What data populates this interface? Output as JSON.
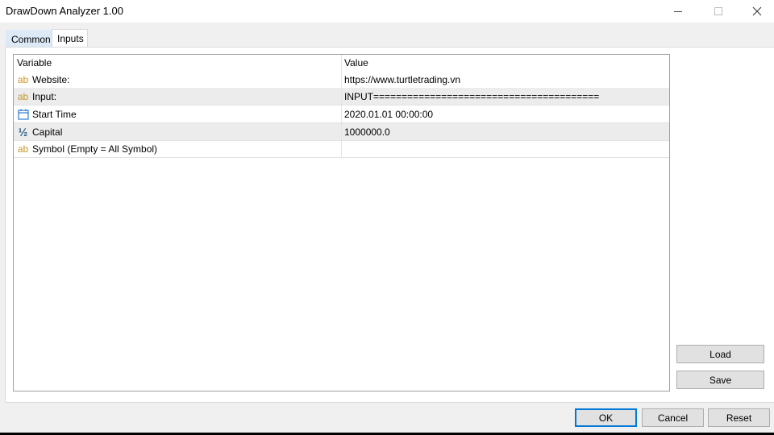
{
  "window": {
    "title": "DrawDown Analyzer 1.00",
    "controls": [
      "minimize-icon",
      "maximize-icon",
      "close-icon"
    ]
  },
  "tabs": [
    {
      "label": "Common",
      "active": false
    },
    {
      "label": "Inputs",
      "active": true
    }
  ],
  "grid": {
    "columns": [
      "Variable",
      "Value"
    ],
    "rows": [
      {
        "icon": "ab-text-icon",
        "icon_glyph": "ab",
        "variable": "Website:",
        "value": "https://www.turtletrading.vn"
      },
      {
        "icon": "ab-text-icon",
        "icon_glyph": "ab",
        "variable": "Input:",
        "value": "INPUT========================================"
      },
      {
        "icon": "calendar-icon",
        "icon_glyph": "",
        "variable": "Start Time",
        "value": "2020.01.01 00:00:00"
      },
      {
        "icon": "fraction-icon",
        "icon_glyph": "½",
        "variable": "Capital",
        "value": "1000000.0"
      },
      {
        "icon": "ab-text-icon",
        "icon_glyph": "ab",
        "variable": "Symbol  (Empty = All Symbol)",
        "value": ""
      }
    ]
  },
  "side_buttons": {
    "load": "Load",
    "save": "Save"
  },
  "footer_buttons": {
    "ok": "OK",
    "cancel": "Cancel",
    "reset": "Reset"
  },
  "colors": {
    "ab_icon": "#c9962a",
    "calendar_icon": "#2b7cd3",
    "fraction_icon": "#2c5f8a",
    "ok_border": "#0078d7",
    "alt_row": "#ececec"
  }
}
